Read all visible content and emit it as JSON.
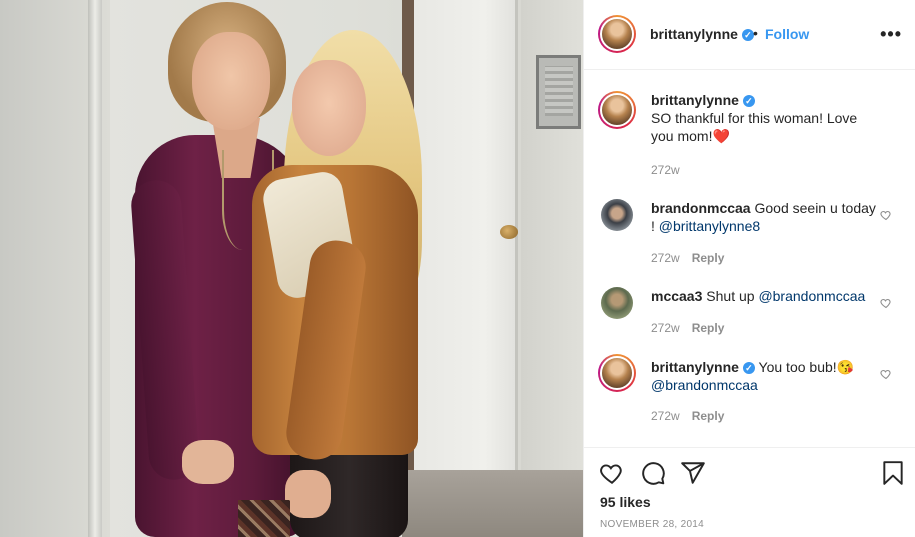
{
  "post": {
    "username": "brittanylynne",
    "verified_mark": "✓",
    "separator": "•",
    "follow_label": "Follow",
    "more_label": "•••"
  },
  "comments": [
    {
      "username": "brittanylynne",
      "verified": true,
      "text": "SO thankful for this woman! Love you mom!",
      "emoji": "❤️",
      "time": "272w",
      "reply_label": ""
    },
    {
      "username": "brandonmccaa",
      "verified": false,
      "text": "Good seein u today ! ",
      "mention": "@brittanylynne8",
      "time": "272w",
      "reply_label": "Reply"
    },
    {
      "username": "mccaa3",
      "verified": false,
      "text": "Shut up ",
      "mention": "@brandonmccaa",
      "time": "272w",
      "reply_label": "Reply"
    },
    {
      "username": "brittanylynne",
      "verified": true,
      "text": "You too bub!",
      "emoji": "😘",
      "mention": "@brandonmccaa",
      "time": "272w",
      "reply_label": "Reply"
    }
  ],
  "footer": {
    "likes": "95 likes",
    "date": "NOVEMBER 28, 2014"
  },
  "icons": [
    "heart-icon",
    "comment-icon",
    "share-icon",
    "bookmark-icon",
    "more-icon",
    "verified-icon"
  ],
  "colors": {
    "accent": "#3897f0",
    "heart": "#ed4956",
    "muted": "#8e8e8e"
  }
}
